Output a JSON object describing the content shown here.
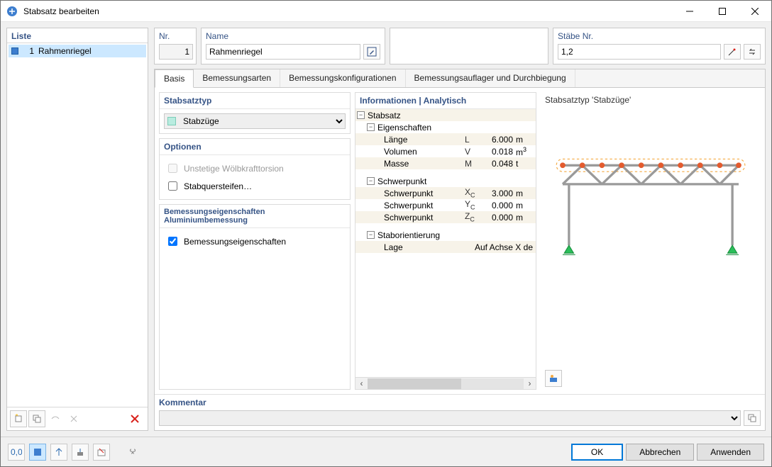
{
  "window": {
    "title": "Stabsatz bearbeiten"
  },
  "liste": {
    "header": "Liste",
    "items": [
      {
        "num": "1",
        "label": "Rahmenriegel",
        "selected": true
      }
    ]
  },
  "fields": {
    "nr_label": "Nr.",
    "nr_value": "1",
    "name_label": "Name",
    "name_value": "Rahmenriegel",
    "staebe_label": "Stäbe Nr.",
    "staebe_value": "1,2"
  },
  "tabs": [
    "Basis",
    "Bemessungsarten",
    "Bemessungskonfigurationen",
    "Bemessungsauflager und Durchbiegung"
  ],
  "active_tab": 0,
  "stabsatztyp": {
    "header": "Stabsatztyp",
    "value": "Stabzüge"
  },
  "optionen": {
    "header": "Optionen",
    "unstetige": "Unstetige Wölbkrafttorsion",
    "stabquer": "Stabquersteifen"
  },
  "bemessung": {
    "header": "Bemessungseigenschaften Aluminiumbemessung",
    "chk": "Bemessungseigenschaften"
  },
  "info": {
    "header": "Informationen | Analytisch",
    "stabsatz": "Stabsatz",
    "eigenschaften": "Eigenschaften",
    "rows_eig": [
      {
        "label": "Länge",
        "sym": "L",
        "val": "6.000",
        "unit": "m"
      },
      {
        "label": "Volumen",
        "sym": "V",
        "val": "0.018",
        "unit": "m³"
      },
      {
        "label": "Masse",
        "sym": "M",
        "val": "0.048",
        "unit": "t"
      }
    ],
    "schwerpunkt": "Schwerpunkt",
    "rows_sp": [
      {
        "label": "Schwerpunkt",
        "sym": "X꜀",
        "val": "3.000",
        "unit": "m"
      },
      {
        "label": "Schwerpunkt",
        "sym": "Y꜀",
        "val": "0.000",
        "unit": "m"
      },
      {
        "label": "Schwerpunkt",
        "sym": "Z꜀",
        "val": "0.000",
        "unit": "m"
      }
    ],
    "staborient": "Staborientierung",
    "lage_label": "Lage",
    "lage_val": "Auf Achse X de"
  },
  "preview_header": "Stabsatztyp 'Stabzüge'",
  "kommentar": {
    "label": "Kommentar"
  },
  "buttons": {
    "ok": "OK",
    "cancel": "Abbrechen",
    "apply": "Anwenden"
  }
}
